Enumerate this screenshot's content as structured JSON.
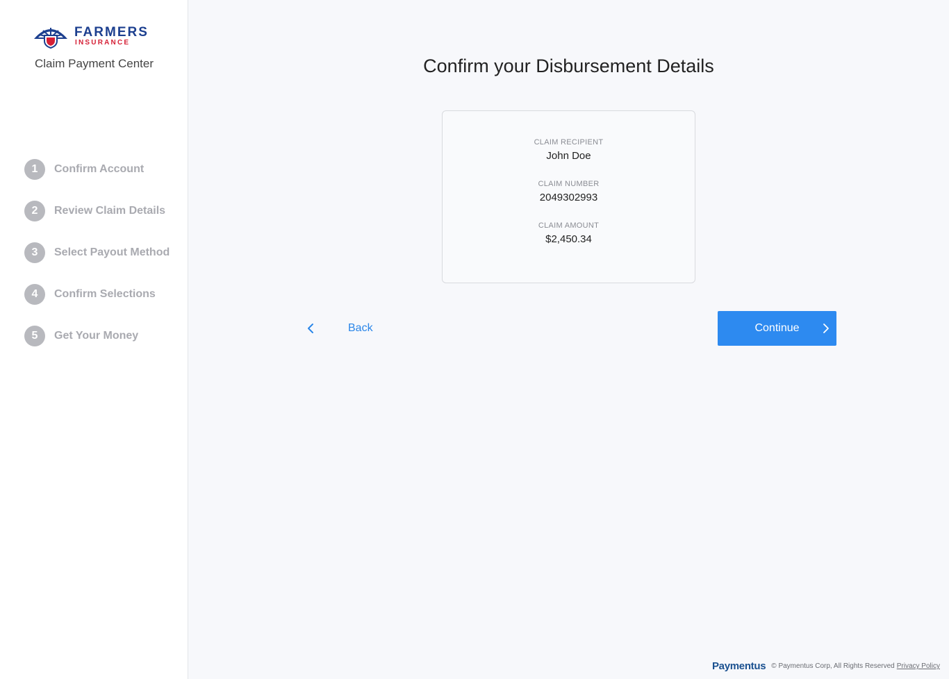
{
  "brand": {
    "name": "FARMERS",
    "sub": "INSURANCE",
    "reg_mark": "®",
    "primary_color": "#1c3f8f",
    "secondary_color": "#d51f35"
  },
  "sidebar": {
    "app_title": "Claim Payment Center",
    "steps": [
      {
        "number": "1",
        "label": "Confirm Account"
      },
      {
        "number": "2",
        "label": "Review Claim Details"
      },
      {
        "number": "3",
        "label": "Select Payout Method"
      },
      {
        "number": "4",
        "label": "Confirm Selections"
      },
      {
        "number": "5",
        "label": "Get Your Money"
      }
    ]
  },
  "main": {
    "title": "Confirm your Disbursement Details",
    "details": {
      "recipient_label": "CLAIM RECIPIENT",
      "recipient_value": "John Doe",
      "number_label": "CLAIM NUMBER",
      "number_value": "2049302993",
      "amount_label": "CLAIM AMOUNT",
      "amount_value": "$2,450.34"
    },
    "back_label": "Back",
    "continue_label": "Continue",
    "accent_color": "#2d8af0"
  },
  "footer": {
    "brand": "Paymentus",
    "copyright": "© Paymentus Corp, All Rights Reserved",
    "privacy_link": "Privacy Policy"
  },
  "icons": {
    "logo": "farmers-logo",
    "back": "chevron-left-icon",
    "continue": "chevron-right-icon"
  }
}
